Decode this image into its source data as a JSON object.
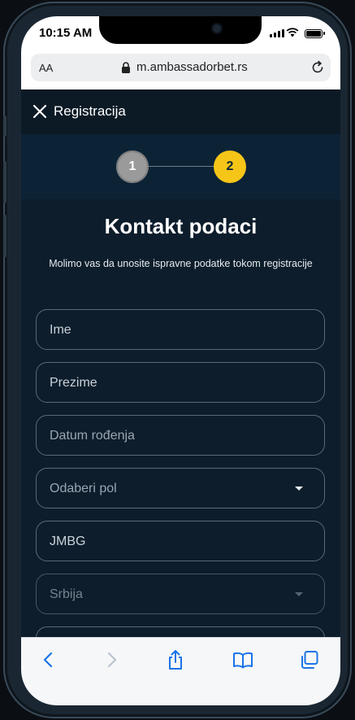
{
  "status_bar": {
    "time": "10:15 AM"
  },
  "browser": {
    "text_size_label": "AA",
    "url": "m.ambassadorbet.rs"
  },
  "app_bar": {
    "title": "Registracija"
  },
  "stepper": {
    "steps": [
      "1",
      "2"
    ],
    "active_step": 2
  },
  "page": {
    "title": "Kontakt podaci",
    "subtitle": "Molimo vas da unosite ispravne podatke tokom registracije"
  },
  "form": {
    "fields": [
      {
        "label": "Ime"
      },
      {
        "label": "Prezime"
      },
      {
        "label": "Datum rođenja"
      },
      {
        "label": "Odaberi pol"
      },
      {
        "label": "JMBG"
      },
      {
        "label": "Srbija"
      }
    ]
  },
  "colors": {
    "accent": "#f5c518",
    "background": "#0d1d2b"
  },
  "icons": {
    "close": "close-icon",
    "lock": "lock-icon",
    "reload": "reload-icon",
    "back": "back-icon",
    "forward": "forward-icon",
    "share": "share-icon",
    "bookmarks": "bookmarks-icon",
    "tabs": "tabs-icon"
  }
}
